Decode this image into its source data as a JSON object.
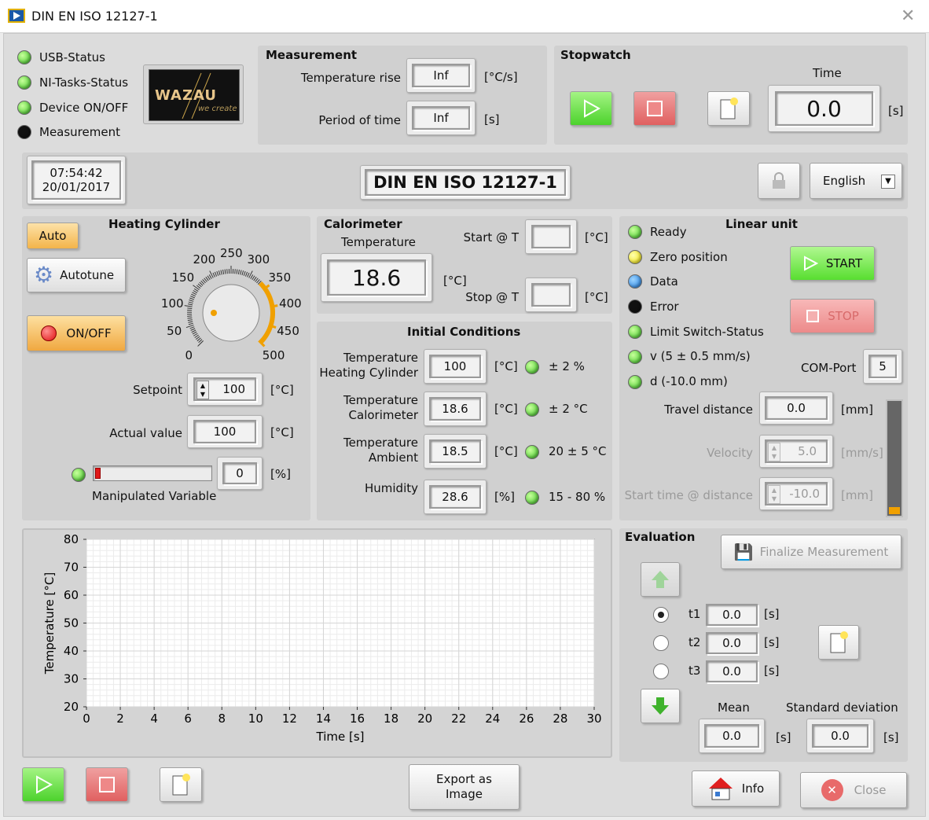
{
  "window": {
    "title": "DIN EN ISO 12127-1",
    "close_icon": "close-icon"
  },
  "status": {
    "usb": "USB-Status",
    "ni_tasks": "NI-Tasks-Status",
    "device": "Device ON/OFF",
    "measurement": "Measurement"
  },
  "logo": {
    "brand": "WAZAU",
    "tagline": "we create"
  },
  "measurement": {
    "title": "Measurement",
    "temp_rise_label": "Temperature rise",
    "temp_rise_value": "Inf",
    "temp_rise_unit": "[°C/s]",
    "period_label": "Period of time",
    "period_value": "Inf",
    "period_unit": "[s]"
  },
  "stopwatch": {
    "title": "Stopwatch",
    "time_label": "Time",
    "time_value": "0.0",
    "time_unit": "[s]"
  },
  "header": {
    "time": "07:54:42",
    "date": "20/01/2017",
    "banner": "DIN EN ISO 12127-1",
    "language": "English"
  },
  "heating": {
    "title": "Heating Cylinder",
    "auto": "Auto",
    "autotune": "Autotune",
    "onoff": "ON/OFF",
    "knob_ticks": [
      "0",
      "50",
      "100",
      "150",
      "200",
      "250",
      "300",
      "350",
      "400",
      "450",
      "500"
    ],
    "setpoint_label": "Setpoint",
    "setpoint_value": "100",
    "setpoint_unit": "[°C]",
    "actual_label": "Actual value",
    "actual_value": "100",
    "actual_unit": "[°C]",
    "mv_label": "Manipulated Variable",
    "mv_value": "0",
    "mv_unit": "[%]",
    "mv_fraction": 0.02
  },
  "calorimeter": {
    "title": "Calorimeter",
    "temp_label": "Temperature",
    "temp_value": "18.6",
    "temp_unit": "[°C]",
    "start_label": "Start @ T",
    "start_unit": "[°C]",
    "stop_label": "Stop @ T",
    "stop_unit": "[°C]"
  },
  "initial": {
    "title": "Initial Conditions",
    "rows": [
      {
        "label1": "Temperature",
        "label2": "Heating Cylinder",
        "value": "100",
        "unit": "[°C]",
        "tol": "± 2 %"
      },
      {
        "label1": "Temperature",
        "label2": "Calorimeter",
        "value": "18.6",
        "unit": "[°C]",
        "tol": "± 2 °C"
      },
      {
        "label1": "Temperature",
        "label2": "Ambient",
        "value": "18.5",
        "unit": "[°C]",
        "tol": "20 ± 5 °C"
      },
      {
        "label1": "",
        "label2": "Humidity",
        "value": "28.6",
        "unit": "[%]",
        "tol": "15 - 80 %"
      }
    ]
  },
  "linear": {
    "title": "Linear unit",
    "ready": "Ready",
    "zero": "Zero position",
    "data": "Data",
    "error": "Error",
    "limit": "Limit Switch-Status",
    "velocity_check": "v (5 ± 0.5 mm/s)",
    "distance_check": "d (-10.0 mm)",
    "start": "START",
    "stop": "STOP",
    "com_label": "COM-Port",
    "com_value": "5",
    "travel_label": "Travel distance",
    "travel_value": "0.0",
    "travel_unit": "[mm]",
    "velocity_label": "Velocity",
    "velocity_value": "5.0",
    "velocity_unit": "[mm/s]",
    "starttime_label": "Start time @ distance",
    "starttime_value": "-10.0",
    "starttime_unit": "[mm]",
    "level_fraction": 0.03
  },
  "chart_data": {
    "type": "line",
    "xlabel": "Time [s]",
    "ylabel": "Temperature [°C]",
    "xlim": [
      0,
      30
    ],
    "ylim": [
      20,
      80
    ],
    "xticks": [
      0,
      2,
      4,
      6,
      8,
      10,
      12,
      14,
      16,
      18,
      20,
      22,
      24,
      26,
      28,
      30
    ],
    "yticks": [
      20,
      30,
      40,
      50,
      60,
      70,
      80
    ],
    "series": [],
    "grid": true
  },
  "evaluation": {
    "title": "Evaluation",
    "finalize": "Finalize Measurement",
    "t1_label": "t1",
    "t1_value": "0.0",
    "t2_label": "t2",
    "t2_value": "0.0",
    "t3_label": "t3",
    "t3_value": "0.0",
    "unit": "[s]",
    "mean_label": "Mean",
    "mean_value": "0.0",
    "std_label": "Standard deviation",
    "std_value": "0.0"
  },
  "footer": {
    "export": "Export as Image",
    "info": "Info",
    "close": "Close"
  }
}
